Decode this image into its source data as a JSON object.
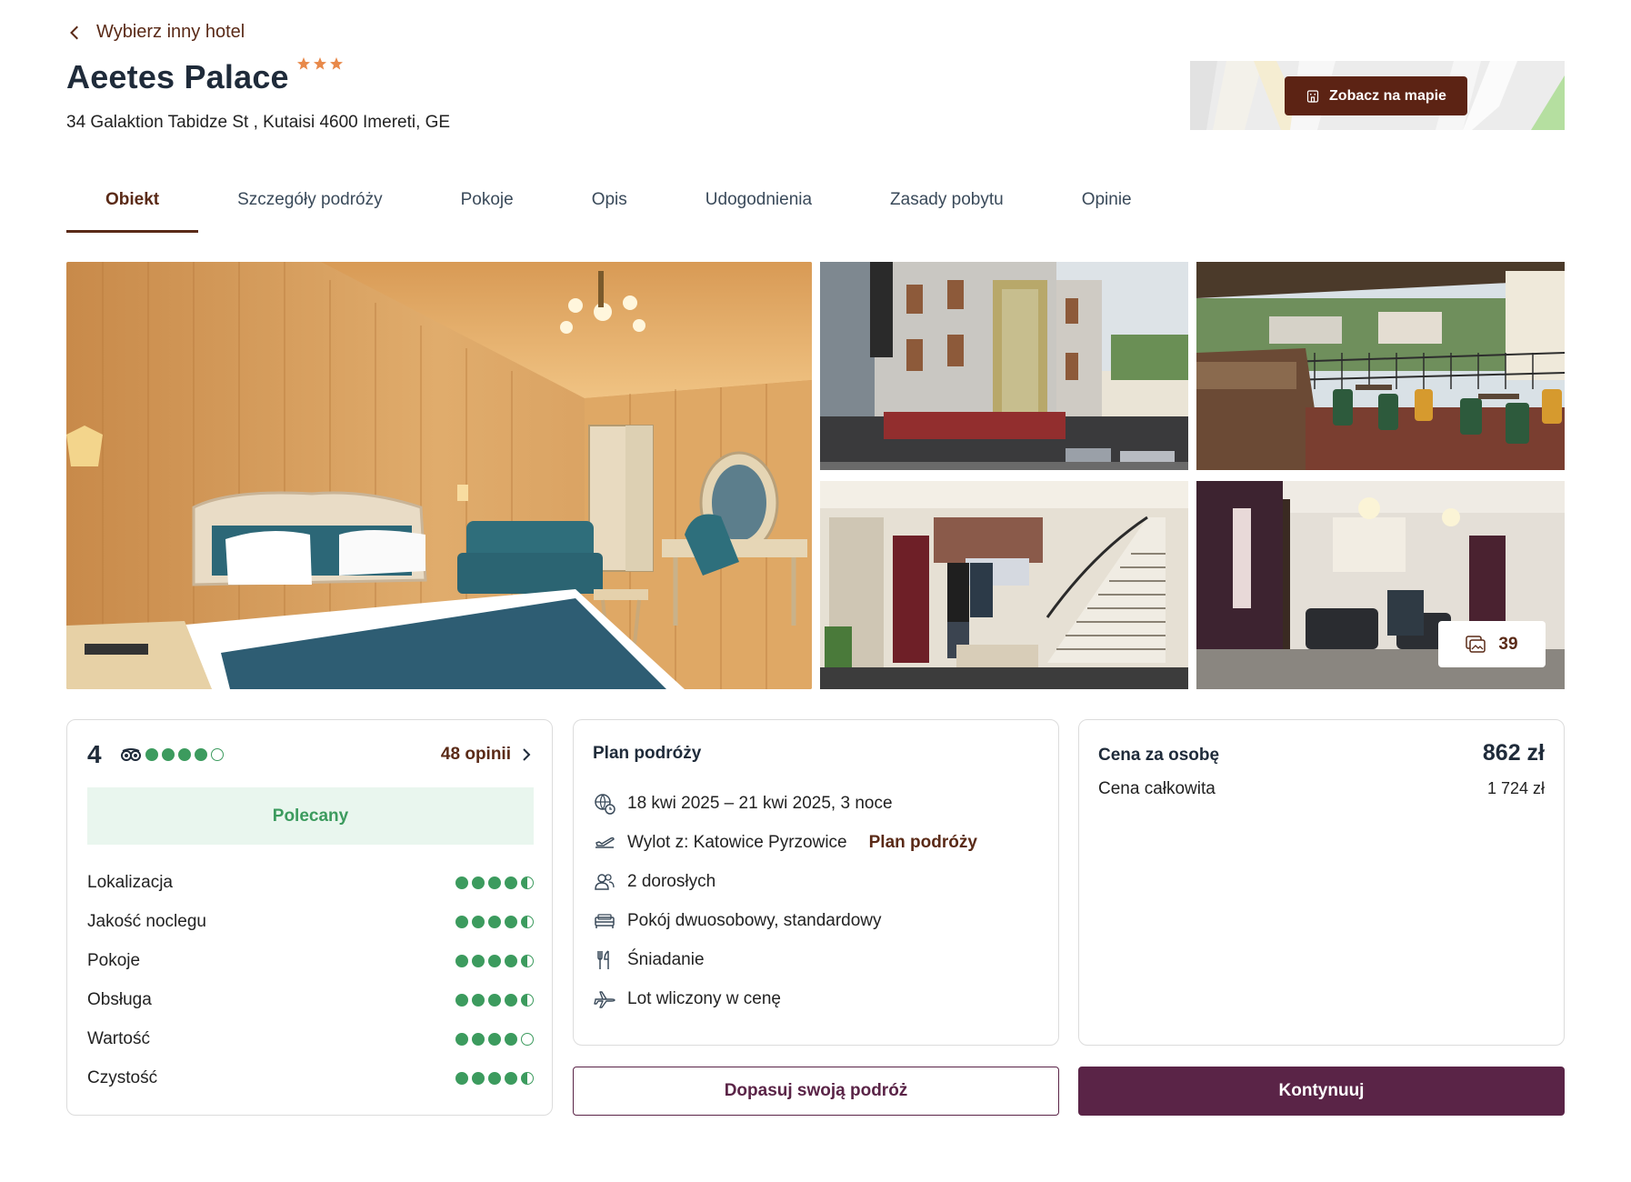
{
  "header": {
    "back_label": "Wybierz inny hotel",
    "hotel_name": "Aeetes Palace",
    "stars": 3,
    "address": "34 Galaktion Tabidze St , Kutaisi 4600 Imereti, GE",
    "map_button": "Zobacz na mapie"
  },
  "tabs": [
    {
      "label": "Obiekt",
      "active": true
    },
    {
      "label": "Szczegóły podróży"
    },
    {
      "label": "Pokoje"
    },
    {
      "label": "Opis"
    },
    {
      "label": "Udogodnienia"
    },
    {
      "label": "Zasady pobytu"
    },
    {
      "label": "Opinie"
    }
  ],
  "gallery": {
    "photo_count": "39"
  },
  "rating": {
    "score": "4",
    "dots": [
      1,
      1,
      1,
      1,
      0
    ],
    "reviews_link": "48 opinii",
    "badge": "Polecany",
    "categories": [
      {
        "label": "Lokalizacja",
        "value": 4.5
      },
      {
        "label": "Jakość noclegu",
        "value": 4.5
      },
      {
        "label": "Pokoje",
        "value": 4.5
      },
      {
        "label": "Obsługa",
        "value": 4.5
      },
      {
        "label": "Wartość",
        "value": 4.0
      },
      {
        "label": "Czystość",
        "value": 4.5
      }
    ]
  },
  "plan": {
    "title": "Plan podróży",
    "items": [
      {
        "icon": "calendar-globe-icon",
        "text": "18 kwi 2025 – 21 kwi 2025, 3 noce"
      },
      {
        "icon": "plane-departure-icon",
        "text": "Wylot z: Katowice Pyrzowice",
        "link": "Plan podróży"
      },
      {
        "icon": "people-icon",
        "text": "2 dorosłych"
      },
      {
        "icon": "bed-icon",
        "text": "Pokój dwuosobowy, standardowy"
      },
      {
        "icon": "cutlery-icon",
        "text": "Śniadanie"
      },
      {
        "icon": "plane-icon",
        "text": "Lot wliczony w cenę"
      }
    ]
  },
  "price": {
    "per_person_label": "Cena za osobę",
    "per_person_value": "862 zł",
    "total_label": "Cena całkowita",
    "total_value": "1 724 zł"
  },
  "actions": {
    "customize": "Dopasuj swoją podróż",
    "continue": "Kontynuuj"
  },
  "colors": {
    "brand_brown": "#5a2a17",
    "primary_purple": "#5a2447",
    "rating_green": "#3c9b5e",
    "star_orange": "#e8894a"
  }
}
